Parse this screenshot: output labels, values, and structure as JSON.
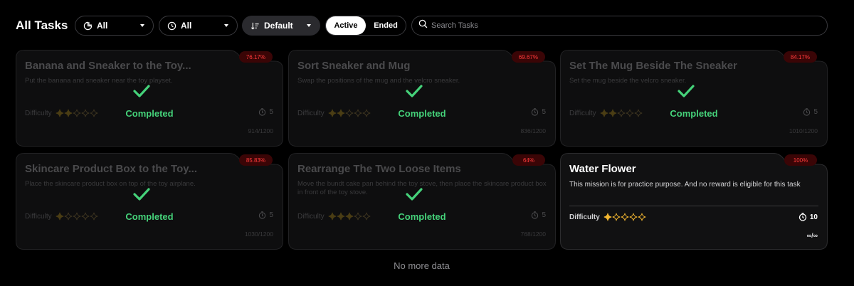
{
  "header": {
    "title": "All Tasks",
    "filter_category": "All",
    "filter_time": "All",
    "sort": "Default",
    "toggle_active": "Active",
    "toggle_ended": "Ended",
    "search_placeholder": "Search Tasks",
    "search_value": ""
  },
  "tasks": [
    {
      "title": "Banana and Sneaker to the Toy...",
      "description": "Put the banana and sneaker near the toy playset.",
      "difficulty_label": "Difficulty",
      "difficulty": 2,
      "duration": "5",
      "progress": "914/1200",
      "percent": "76.17%",
      "status": "Completed"
    },
    {
      "title": "Sort Sneaker and Mug",
      "description": "Swap the positions of the mug and the velcro sneaker.",
      "difficulty_label": "Difficulty",
      "difficulty": 2,
      "duration": "5",
      "progress": "836/1200",
      "percent": "69.67%",
      "status": "Completed"
    },
    {
      "title": "Set The Mug Beside The Sneaker",
      "description": "Set the mug beside the velcro sneaker.",
      "difficulty_label": "Difficulty",
      "difficulty": 2,
      "duration": "5",
      "progress": "1010/1200",
      "percent": "84.17%",
      "status": "Completed"
    },
    {
      "title": "Skincare Product Box to the Toy...",
      "description": "Place the skincare product box on top of the toy airplane.",
      "difficulty_label": "Difficulty",
      "difficulty": 1,
      "duration": "5",
      "progress": "1030/1200",
      "percent": "85.83%",
      "status": "Completed"
    },
    {
      "title": "Rearrange The Two Loose Items",
      "description": "Move the bundt cake pan behind the toy stove, then place the skincare product box in front of the toy stove.",
      "difficulty_label": "Difficulty",
      "difficulty": 3,
      "duration": "5",
      "progress": "768/1200",
      "percent": "64%",
      "status": "Completed"
    },
    {
      "title": "Water Flower",
      "description": "This mission is for practice purpose. And no reward is eligible for this task",
      "difficulty_label": "Difficulty",
      "difficulty": 1,
      "duration": "10",
      "progress": "∞/∞",
      "percent": "100%",
      "status": ""
    }
  ],
  "footer": {
    "no_more": "No more data"
  },
  "colors": {
    "completed": "#45d27a",
    "badge_text": "#ff3b3b",
    "badge_bg": "#3a0506",
    "star": "#f2b630"
  }
}
